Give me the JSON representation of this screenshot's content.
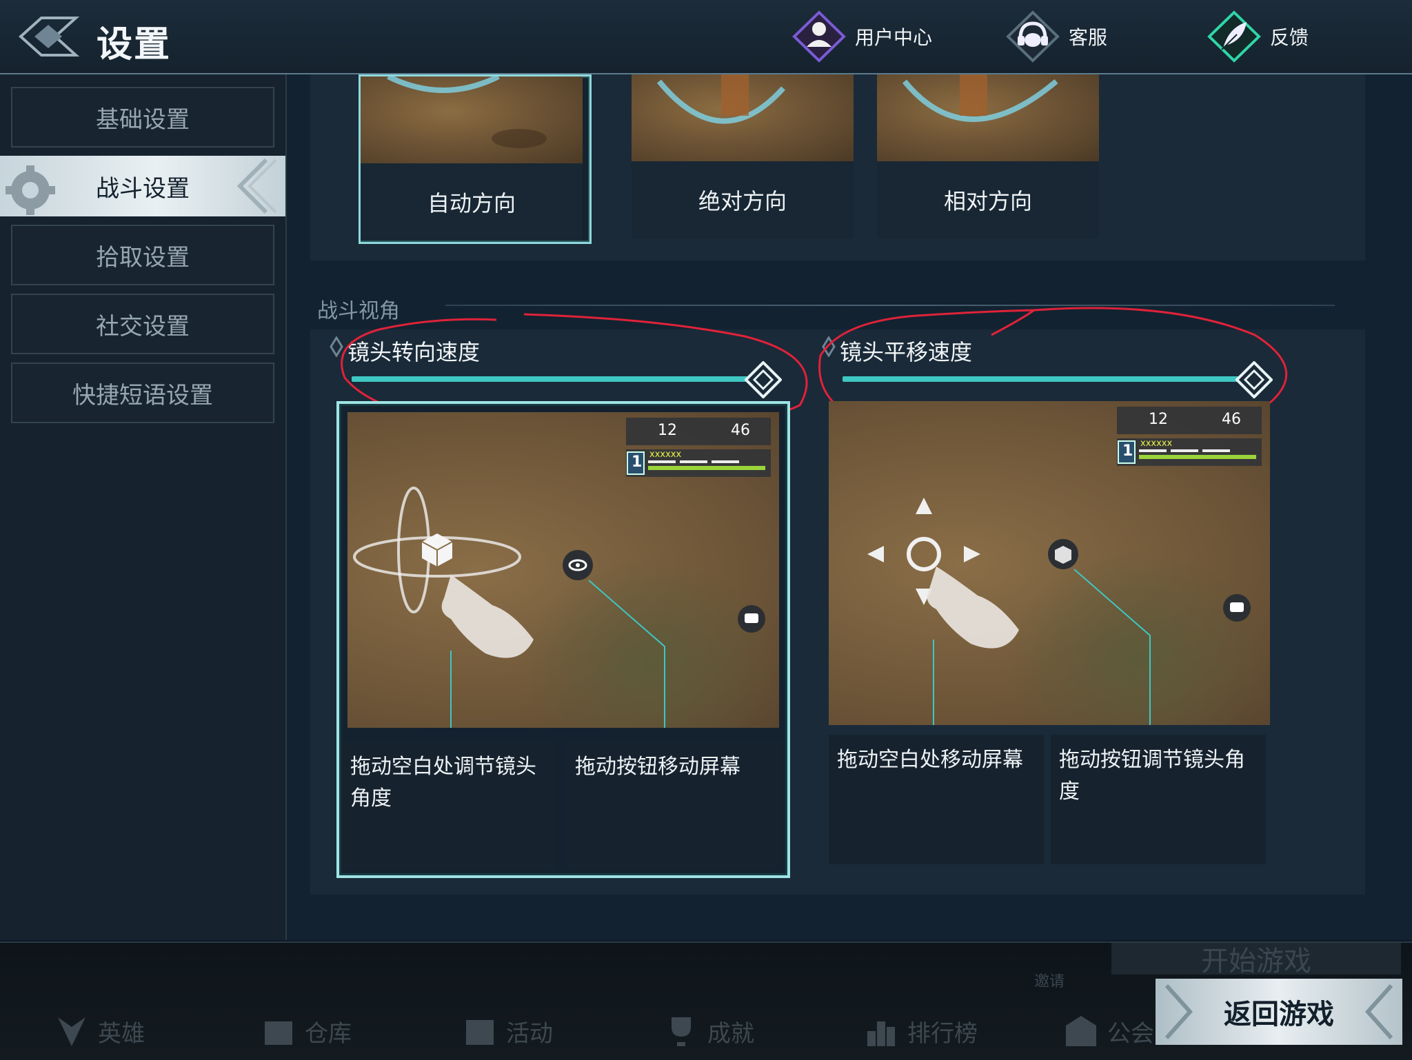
{
  "header": {
    "title": "设置",
    "actions": [
      {
        "label": "用户中心",
        "icon": "user-icon"
      },
      {
        "label": "客服",
        "icon": "headset-icon"
      },
      {
        "label": "反馈",
        "icon": "feather-icon"
      }
    ]
  },
  "sidebar": {
    "items": [
      {
        "label": "基础设置",
        "active": false
      },
      {
        "label": "战斗设置",
        "active": true
      },
      {
        "label": "拾取设置",
        "active": false
      },
      {
        "label": "社交设置",
        "active": false
      },
      {
        "label": "快捷短语设置",
        "active": false
      }
    ]
  },
  "direction": {
    "options": [
      {
        "label": "自动方向",
        "selected": true
      },
      {
        "label": "绝对方向",
        "selected": false
      },
      {
        "label": "相对方向",
        "selected": false
      }
    ]
  },
  "camera": {
    "section_title": "战斗视角",
    "rotate_speed": {
      "label": "镜头转向速度",
      "value": 1.0
    },
    "pan_speed": {
      "label": "镜头平移速度",
      "value": 1.0
    },
    "modes": [
      {
        "selected": true,
        "desc_left": "拖动空白处调节镜头角度",
        "desc_right": "拖动按钮移动屏幕",
        "hud": {
          "kills": "12",
          "players": "46",
          "rank": "1",
          "name": "xxxxxx"
        }
      },
      {
        "selected": false,
        "desc_left": "拖动空白处移动屏幕",
        "desc_right": "拖动按钮调节镜头角度",
        "hud": {
          "kills": "12",
          "players": "46",
          "rank": "1",
          "name": "xxxxxx"
        }
      }
    ]
  },
  "bottombar": {
    "items": [
      "英雄",
      "仓库",
      "活动",
      "成就",
      "排行榜",
      "公会"
    ],
    "invite": "邀请",
    "start": "开始游戏"
  },
  "back_button": "返回游戏",
  "colors": {
    "accent": "#3fc7c3",
    "annotation": "#e0223a",
    "selected_border": "#9fe3e6"
  }
}
